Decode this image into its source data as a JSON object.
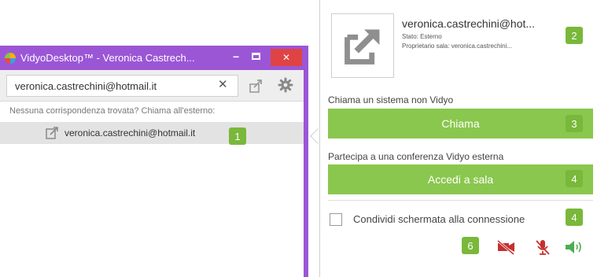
{
  "window": {
    "title": "VidyoDesktop™ - Veronica Castrech...",
    "minimize": "−",
    "close": "✕"
  },
  "search": {
    "value": "veronica.castrechini@hotmail.it",
    "clear": "✕"
  },
  "results": {
    "no_match": "Nessuna corrispondenza trovata? Chiama all'esterno:",
    "item": "veronica.castrechini@hotmail.it"
  },
  "contact": {
    "name": "veronica.castrechini@hot...",
    "status": "Stato: Esterno",
    "owner": "Proprietario sala: veronica.castrechini..."
  },
  "actions": {
    "call_label": "Chiama un sistema non Vidyo",
    "call_button": "Chiama",
    "join_label": "Partecipa a una conferenza Vidyo esterna",
    "join_button": "Accedi a sala",
    "share_label": "Condividi schermata alla connessione"
  },
  "badges": {
    "result": "1",
    "contact": "2",
    "call": "3",
    "join": "4",
    "share": "4",
    "media": "6"
  },
  "colors": {
    "window_frame": "#9b56d6",
    "close_button": "#e04343",
    "green_button": "#8ac74e",
    "badge": "#79b83a",
    "muted_icon": "#c62f2f",
    "speaker_icon": "#4caf50"
  },
  "icons": {
    "share": "share-arrow-icon",
    "settings": "gear-icon",
    "external": "external-link-icon",
    "camera_off": "camera-off-icon",
    "mic_off": "microphone-off-icon",
    "speaker": "speaker-on-icon"
  }
}
